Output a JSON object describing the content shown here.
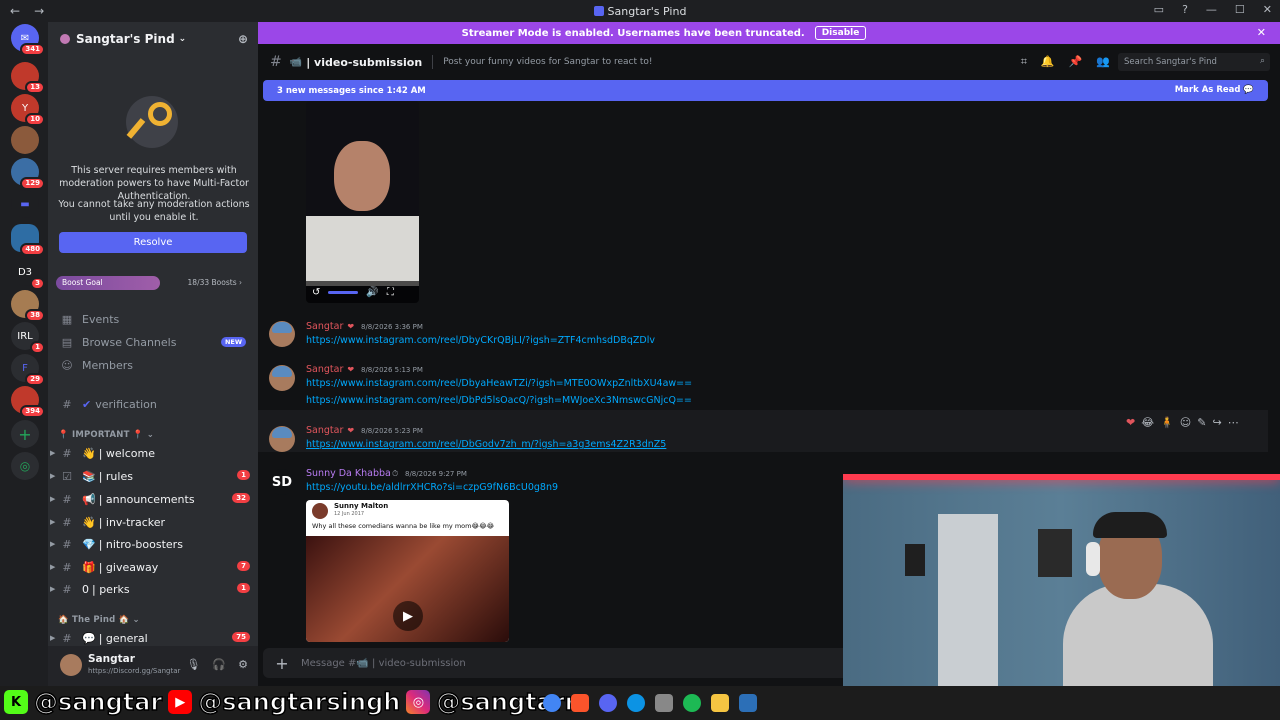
{
  "window": {
    "title": "Sangtar's Pind"
  },
  "streamer": {
    "text": "Streamer Mode is enabled. Usernames have been truncated.",
    "disable_label": "Disable"
  },
  "rail": {
    "servers": [
      {
        "badge": "341"
      },
      {
        "badge": "13"
      },
      {
        "badge": "10"
      },
      {
        "badge": ""
      },
      {
        "badge": "129"
      },
      {
        "badge": ""
      },
      {
        "badge": "480"
      },
      {
        "label": "D3",
        "badge": "3"
      },
      {
        "badge": "38"
      },
      {
        "label": "IRL",
        "badge": "1"
      },
      {
        "badge": "29"
      },
      {
        "badge": "394"
      }
    ]
  },
  "sidebar": {
    "server_name": "Sangtar's Pind",
    "mfa_text_1": "This server requires members with moderation powers to have Multi-Factor Authentication.",
    "mfa_text_2": "You cannot take any moderation actions until you enable it.",
    "resolve_label": "Resolve",
    "boost_label": "Boost Goal",
    "boost_count": "18/33 Boosts",
    "boost_progress": 0.545,
    "menu": [
      {
        "label": "Events"
      },
      {
        "label": "Browse Channels",
        "badge": "NEW"
      },
      {
        "label": "Members"
      }
    ],
    "channels_top": [
      {
        "label": "verification",
        "emoji": "✔"
      }
    ],
    "category_important": "IMPORTANT",
    "channels": [
      {
        "label": "welcome",
        "emoji": "👋",
        "badge": ""
      },
      {
        "label": "rules",
        "emoji": "📚",
        "badge": "1"
      },
      {
        "label": "announcements",
        "emoji": "📢",
        "badge": "32"
      },
      {
        "label": "inv-tracker",
        "emoji": "👋",
        "badge": ""
      },
      {
        "label": "nitro-boosters",
        "emoji": "💎",
        "badge": ""
      },
      {
        "label": "giveaway",
        "emoji": "🎁",
        "badge": "7"
      },
      {
        "label": "perks",
        "emoji": "0",
        "badge": "1"
      }
    ],
    "category_pind": "The Pind",
    "channel_general": {
      "label": "general",
      "emoji": "💬",
      "badge": "75"
    },
    "user": {
      "name": "Sangtar",
      "status": "https://Discord.gg/Sangtar"
    }
  },
  "channel": {
    "name": "video-submission",
    "topic": "Post your funny videos for Sangtar to react to!",
    "search_placeholder": "Search Sangtar's Pind",
    "new_messages": "3 new messages since 1:42 AM",
    "mark_read": "Mark As Read",
    "composer_placeholder": "Message #📹 | video-submission"
  },
  "messages": [
    {
      "author": "Sangtar",
      "time": "8/8/2026 3:36 PM",
      "links": [
        "https://www.instagram.com/reel/DbyCKrQBjLI/?igsh=ZTF4cmhsdDBqZDlv"
      ]
    },
    {
      "author": "Sangtar",
      "time": "8/8/2026 5:13 PM",
      "links": [
        "https://www.instagram.com/reel/DbyaHeawTZi/?igsh=MTE0OWxpZnltbXU4aw==",
        "https://www.instagram.com/reel/DbPd5lsOacQ/?igsh=MWJoeXc3NmswcGNjcQ=="
      ]
    },
    {
      "author": "Sangtar",
      "time": "8/8/2026 5:23 PM",
      "links": [
        "https://www.instagram.com/reel/DbGodv7zh_m/?igsh=a3g3ems4Z2R3dnZ5"
      ]
    },
    {
      "author": "Sunny Da Khabba",
      "avatar_text": "SD",
      "time": "8/8/2026 9:27 PM",
      "links": [
        "https://youtu.be/aldlrrXHCRo?si=czpG9fN6BcU0g8n9"
      ]
    }
  ],
  "embed": {
    "poster": "Sunny Malton",
    "date": "12 Jun 2017",
    "caption": "Why all these comedians wanna be like my mom😂😂😂"
  },
  "taskbar": {
    "socials": [
      "@sangtar",
      "@sangtarsingh",
      "@sangtarr"
    ]
  },
  "colors": {
    "brand": "#5865f2",
    "streamer": "#9b47e8",
    "author_red": "#e0555c",
    "link": "#00a8fc"
  }
}
